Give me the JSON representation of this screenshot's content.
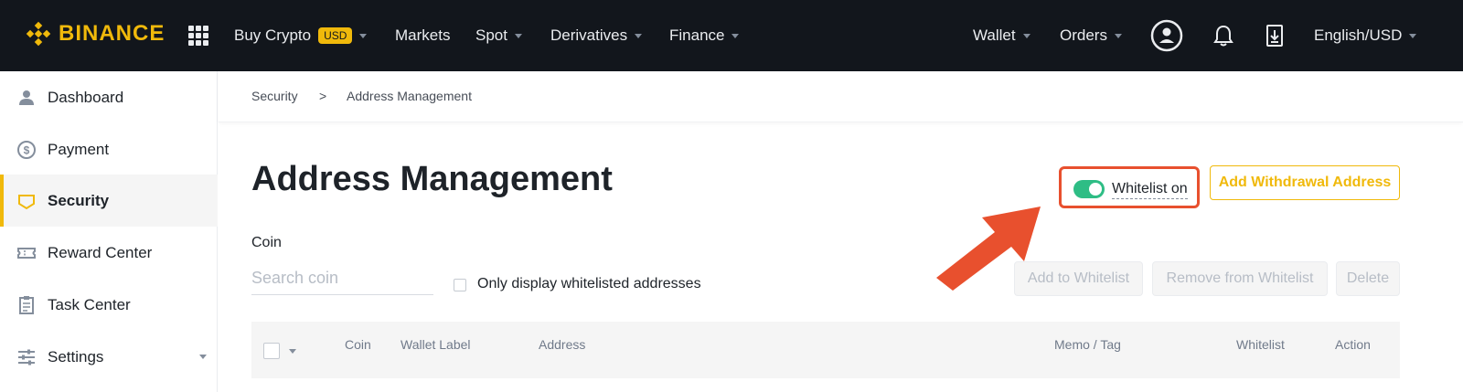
{
  "topbar": {
    "brand": "BINANCE",
    "nav_left": [
      {
        "label": "Buy Crypto",
        "badge": "USD"
      },
      {
        "label": "Markets"
      },
      {
        "label": "Spot"
      },
      {
        "label": "Derivatives"
      },
      {
        "label": "Finance"
      }
    ],
    "nav_right": [
      {
        "label": "Wallet"
      },
      {
        "label": "Orders"
      }
    ],
    "language": "English/USD",
    "icons": [
      "apps-grid-icon",
      "user-circle-icon",
      "bell-icon",
      "download-icon"
    ]
  },
  "sidebar": {
    "items": [
      {
        "label": "Dashboard",
        "icon": "user-icon"
      },
      {
        "label": "Payment",
        "icon": "dollar-icon"
      },
      {
        "label": "Security",
        "icon": "shield-icon",
        "active": true
      },
      {
        "label": "Reward Center",
        "icon": "ticket-icon"
      },
      {
        "label": "Task Center",
        "icon": "clipboard-icon"
      },
      {
        "label": "Settings",
        "icon": "sliders-icon"
      }
    ]
  },
  "breadcrumb": {
    "parent": "Security",
    "separator": ">",
    "current": "Address Management"
  },
  "main": {
    "title": "Address Management",
    "whitelist_label": "Whitelist on",
    "whitelist_on": true,
    "add_button": "Add Withdrawal Address",
    "coin_label": "Coin",
    "search_placeholder": "Search coin",
    "only_whitelisted_label": "Only display whitelisted addresses",
    "actions": {
      "add_to_whitelist": "Add to Whitelist",
      "remove_from_whitelist": "Remove from Whitelist",
      "delete": "Delete"
    },
    "table": {
      "columns": [
        "Coin",
        "Wallet Label",
        "Address",
        "Memo / Tag",
        "Whitelist",
        "Action"
      ]
    }
  },
  "colors": {
    "brand": "#f0b90b",
    "topbar_bg": "#12161c",
    "toggle_on": "#2ebd85",
    "highlight": "#e8502e"
  }
}
